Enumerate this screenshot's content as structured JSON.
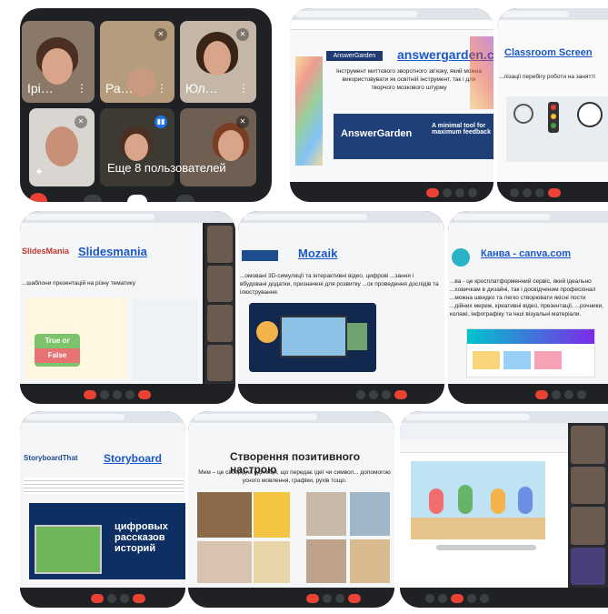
{
  "video_grid": {
    "participants": [
      {
        "name": "Ірі…"
      },
      {
        "name": "Ра…"
      },
      {
        "name": "Юл…"
      },
      {
        "name": ""
      },
      {
        "name": ""
      },
      {
        "name": ""
      }
    ],
    "more_users_label": "Еще 8 пользователей"
  },
  "slides": {
    "answergarden": {
      "title": "answergarden.ch",
      "logo": "AnswerGarden",
      "text": "Інструмент миттєвого зворотного зв'язку, який можна використовувати як освітній інструмент, так і для творчого мозкового штурму",
      "banner_title": "AnswerGarden",
      "banner_tagline": "A minimal tool for maximum feedback"
    },
    "classroomscreen": {
      "title": "Classroom Screen",
      "text": "...лізації перебігу роботи на занятті"
    },
    "slidesmania": {
      "title": "Slidesmania",
      "logo": "SlidesMania",
      "text": "...шаблони презентацій на різну тематику",
      "card_true": "True or",
      "card_false": "False"
    },
    "mozaik": {
      "title": "Mozaik",
      "text": "...омовані 3D-симуляції та інтерактивні відео, цифрові ...зання і вбудовані додатки, призначені для розвитку ...ок проведення дослідів та ілюстрування."
    },
    "canva": {
      "title": "Канва - canva.com",
      "text": "...ва - це кросплатформенний сервіс, який ідеально ...ховичкам в дизайні, так і досвідченим професіонал ...можна швидко та легко створювати якісні пости ...дійних мереж, креативні відео, презентації, ...рочники, колажі, інфографіку та інші візуальні матеріали."
    },
    "storyboard": {
      "title": "Storyboard",
      "logo": "StoryboardThat",
      "banner_text": "цифровых рассказов историй"
    },
    "positive_mood": {
      "title": "Створення позитивного настрою",
      "text": "Мем – це своєрідна одиниця, що передає ідеї чи символ... допомогою усного мовлення, графіки, рухів тощо."
    }
  },
  "colors": {
    "meet_bg": "#202124",
    "leave_red": "#ea4335",
    "link_blue": "#1a57c9",
    "mic_badge_blue": "#1a73e8"
  }
}
